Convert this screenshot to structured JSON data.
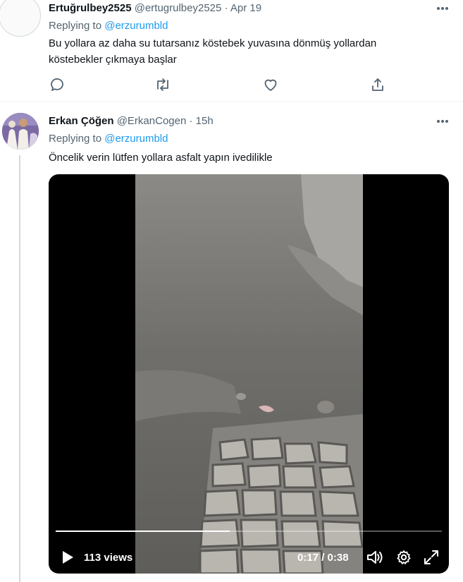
{
  "tweets": [
    {
      "name": "Ertuğrulbey2525",
      "handle": "@ertugrulbey2525",
      "separator": "·",
      "time": "Apr 19",
      "replying_prefix": "Replying to",
      "replying_to": "@erzurumbld",
      "text_line1": "Bu yollara az daha su tutarsanız köstebek yuvasına dönmüş yollardan",
      "text_line2": "köstebekler çıkmaya başlar",
      "actions": [
        "reply-icon",
        "retweet-icon",
        "like-icon",
        "share-icon"
      ]
    },
    {
      "name": "Erkan Çöğen",
      "handle": "@ErkanCogen",
      "separator": "·",
      "time": "15h",
      "replying_prefix": "Replying to",
      "replying_to": "@erzurumbld",
      "text": "Öncelik verin lütfen yollara asfalt yapın ivedilikle",
      "video": {
        "views": "113 views",
        "time_display": "0:17 / 0:38",
        "progress": 0.45,
        "icons": [
          "play-icon",
          "volume-icon",
          "settings-icon",
          "fullscreen-icon"
        ]
      }
    }
  ],
  "colors": {
    "link": "#1d9bf0",
    "secondary": "#536471",
    "text": "#0f1419",
    "divider": "#eff3f4"
  }
}
